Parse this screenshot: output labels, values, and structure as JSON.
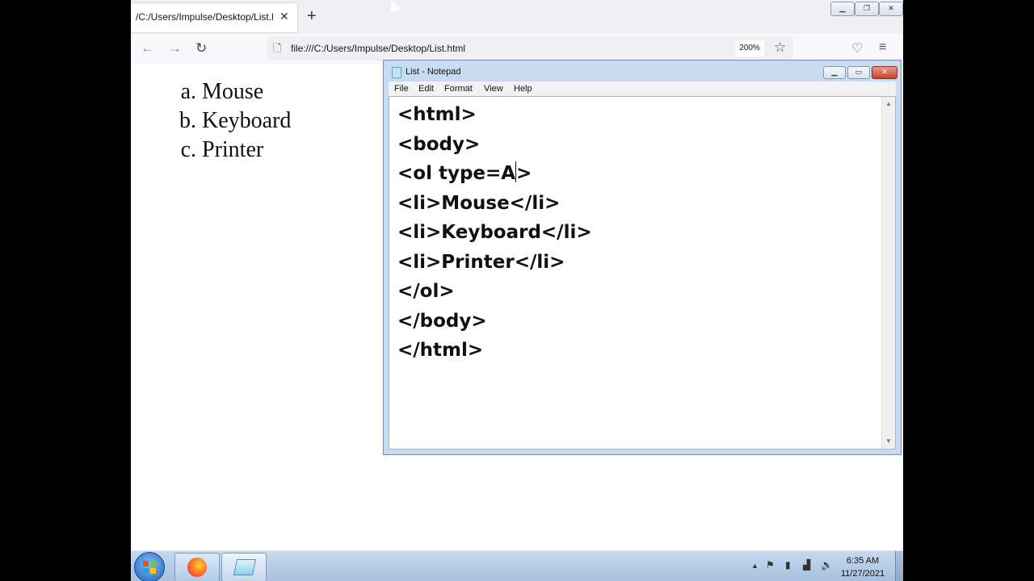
{
  "browser": {
    "tab_title": "/C:/Users/Impulse/Desktop/List.html",
    "tab_close": "✕",
    "new_tab": "+",
    "url": "file:///C:/Users/Impulse/Desktop/List.html",
    "zoom": "200%",
    "icons": [
      "back-arrow-icon",
      "forward-arrow-icon",
      "reload-icon",
      "page-icon",
      "bookmark-star-icon",
      "pocket-icon",
      "menu-icon"
    ]
  },
  "page_list": {
    "items": [
      "Mouse",
      "Keyboard",
      "Printer"
    ]
  },
  "notepad": {
    "title": "List - Notepad",
    "menu": [
      "File",
      "Edit",
      "Format",
      "View",
      "Help"
    ],
    "code": {
      "l1": "<html>",
      "l2": "<body>",
      "l3a": "<ol type=A",
      "l3b": ">",
      "l4": "<li>Mouse</li>",
      "l5": "<li>Keyboard</li>",
      "l6": "<li>Printer</li>",
      "l7": "</ol>",
      "l8": "</body>",
      "l9": "</html>"
    }
  },
  "taskbar": {
    "time": "6:35 AM",
    "date": "11/27/2021"
  }
}
